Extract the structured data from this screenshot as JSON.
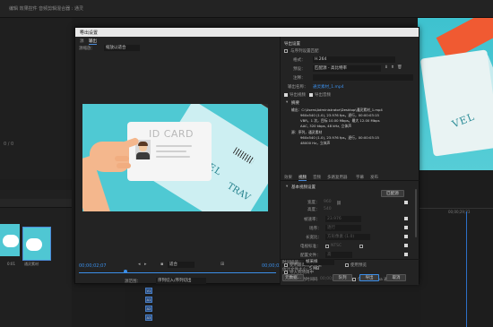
{
  "background": {
    "top_menu": [
      "",
      "",
      "",
      ""
    ],
    "top_text_1": "编辑 效果控件 音频剪辑混合器 : 通灵",
    "top_text_2": "",
    "left_panel_label": "0 / 0",
    "project_clips": [
      {
        "label": "",
        "duration": "0:01"
      },
      {
        "label": "通灵素材",
        "duration": "0:04"
      }
    ],
    "right_timecode": "00;00;29;23"
  },
  "dialog": {
    "title": "导出设置",
    "close_glyph": "✕",
    "tabs": [
      "源",
      "输出"
    ],
    "active_tab": "输出",
    "source_scaling_label": "源缩放：",
    "source_scaling_value": "缩放以适合",
    "timecode_current": "00;00;02;07",
    "timecode_end": "00;00;03;15",
    "fit_value": "适合",
    "source_range_label": "源范围：",
    "source_range_value": "序列切入/序列切出",
    "export_settings": {
      "section_title": "导出设置",
      "match_sequence_label": "与序列设置匹配",
      "format_label": "格式：",
      "format_value": "H.264",
      "preset_label": "预设：",
      "preset_value": "匹配源 - 高比特率",
      "comments_label": "注释：",
      "output_name_label": "输出名称：",
      "output_name_value": "通灵素材_1.mp4",
      "export_video_label": "导出视频",
      "export_audio_label": "导出音频",
      "summary_title": "摘要",
      "output_line1": "输出：C:\\Users\\Administrator\\Desktop\\通灵素材_1.mp4",
      "output_line2": "960x540 (1.0), 23.976 fps，逐行，00:00:03:15",
      "output_line3": "VBR，1 次，目标 10.00 Mbps，最大 12.00 Mbps",
      "output_line4": "AAC, 320 kbps, 48 kHz, 立体声",
      "source_line1": "源：序列，通灵素材",
      "source_line2": "960x540 (1.0), 23.976 fps，逐行，00:00:03:15",
      "source_line3": "48000 Hz，立体声"
    },
    "settings_tabs": [
      "效果",
      "视频",
      "音频",
      "多路复用器",
      "字幕",
      "发布"
    ],
    "active_settings_tab": "视频",
    "basic_video_title": "基本视频设置",
    "match_source_button": "匹配源",
    "video_rows": [
      {
        "label": "宽度：",
        "value": "960"
      },
      {
        "label": "高度：",
        "value": "540"
      },
      {
        "label": "帧速率：",
        "value": "23.976"
      },
      {
        "label": "场序：",
        "value": "逐行"
      },
      {
        "label": "长宽比：",
        "value": "方形像素 (1.0)"
      },
      {
        "label": "电视标准：",
        "value": "NTSC"
      },
      {
        "label": "配置文件：",
        "value": "高"
      }
    ],
    "options": {
      "max_render_quality": "使用最高渲染质量",
      "use_previews": "使用预览",
      "import_to_project": "导入到项目中",
      "set_start_timecode": "设置开始时间码",
      "start_timecode_value": "00;00;00;00",
      "render_alpha_only": "仅渲染 Alpha 通道",
      "time_interpolation_label": "时间插值：",
      "time_interpolation_value": "帧采样",
      "file_size_label": "估计文件大小：",
      "file_size_value": "5 MB"
    },
    "buttons": {
      "metadata": "元数据...",
      "queue": "队列",
      "export": "导出",
      "cancel": "取消"
    }
  },
  "colors": {
    "accent_blue": "#3b8ee8",
    "preview_bg": "#4fc9d3",
    "stripe_orange": "#ef5a2f"
  }
}
